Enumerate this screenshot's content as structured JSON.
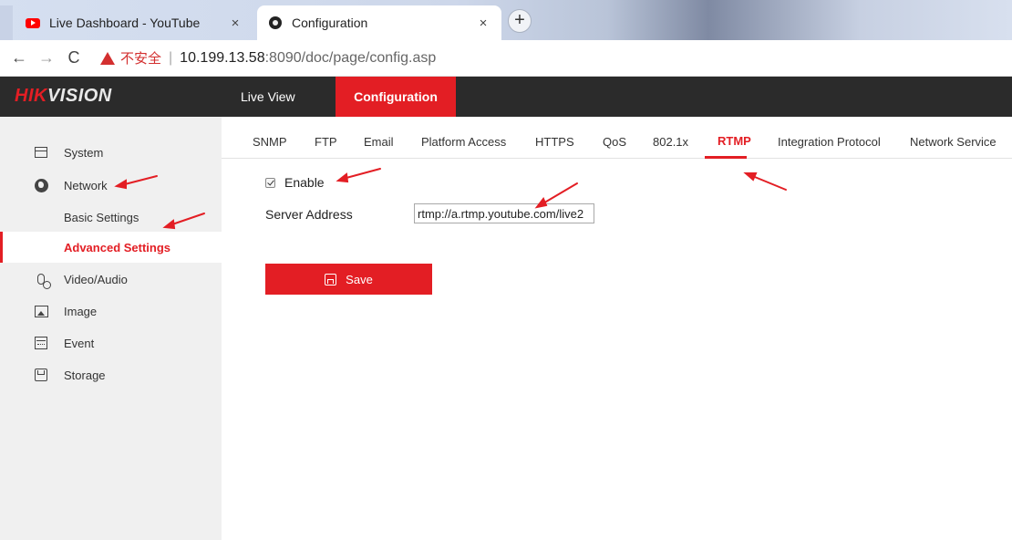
{
  "browser": {
    "tabs": [
      {
        "title": "Live Dashboard - YouTube",
        "favicon": "youtube-icon",
        "active": false
      },
      {
        "title": "Configuration",
        "favicon": "camera-icon",
        "active": true
      }
    ],
    "close_glyph": "×",
    "new_tab_glyph": "+",
    "nav": {
      "back": "←",
      "forward": "→",
      "reload": "C"
    },
    "security_label": "不安全",
    "separator": "|",
    "url_host": "10.199.13.58",
    "url_rest": ":8090/doc/page/config.asp"
  },
  "app": {
    "logo_red": "HIK",
    "logo_white": "VISION",
    "nav": {
      "live_view": "Live View",
      "configuration": "Configuration"
    },
    "accent_color": "#e31e24"
  },
  "sidebar": {
    "items": [
      {
        "label": "System",
        "icon": "system-icon"
      },
      {
        "label": "Network",
        "icon": "network-globe-icon"
      },
      {
        "label": "Basic Settings",
        "sub": true
      },
      {
        "label": "Advanced Settings",
        "sub": true,
        "active": true
      },
      {
        "label": "Video/Audio",
        "icon": "video-audio-icon"
      },
      {
        "label": "Image",
        "icon": "image-icon"
      },
      {
        "label": "Event",
        "icon": "event-calendar-icon"
      },
      {
        "label": "Storage",
        "icon": "storage-disk-icon"
      }
    ]
  },
  "subtabs": [
    "SNMP",
    "FTP",
    "Email",
    "Platform Access",
    "HTTPS",
    "QoS",
    "802.1x",
    "RTMP",
    "Integration Protocol",
    "Network Service"
  ],
  "active_subtab": "RTMP",
  "form": {
    "enable_label": "Enable",
    "enable_checked": true,
    "server_address_label": "Server Address",
    "server_address_value": "rtmp://a.rtmp.youtube.com/live2",
    "save_label": "Save"
  }
}
